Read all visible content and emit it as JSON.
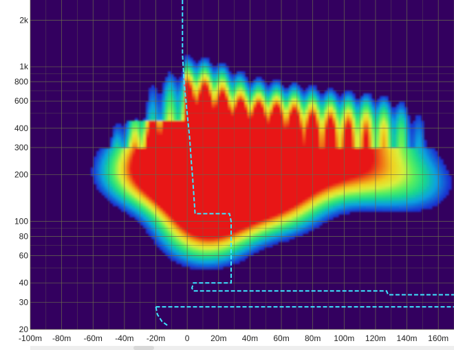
{
  "chart_data": {
    "type": "heatmap",
    "title": "",
    "xlabel": "",
    "ylabel": "",
    "x_scale": "linear",
    "y_scale": "log",
    "xlim": [
      -100,
      170
    ],
    "ylim": [
      20,
      2700
    ],
    "grid": true,
    "x_ticks": [
      {
        "value": -100,
        "label": "-100m"
      },
      {
        "value": -80,
        "label": "-80m"
      },
      {
        "value": -60,
        "label": "-60m"
      },
      {
        "value": -40,
        "label": "-40m"
      },
      {
        "value": -20,
        "label": "-20m"
      },
      {
        "value": 0,
        "label": "0"
      },
      {
        "value": 20,
        "label": "20m"
      },
      {
        "value": 40,
        "label": "40m"
      },
      {
        "value": 60,
        "label": "60m"
      },
      {
        "value": 80,
        "label": "80m"
      },
      {
        "value": 100,
        "label": "100m"
      },
      {
        "value": 120,
        "label": "120m"
      },
      {
        "value": 140,
        "label": "140m"
      },
      {
        "value": 160,
        "label": "160m"
      }
    ],
    "y_ticks": [
      {
        "value": 2000,
        "label": "2k"
      },
      {
        "value": 1000,
        "label": "1k"
      },
      {
        "value": 800,
        "label": "800"
      },
      {
        "value": 600,
        "label": "600"
      },
      {
        "value": 400,
        "label": "400"
      },
      {
        "value": 300,
        "label": "300"
      },
      {
        "value": 200,
        "label": "200"
      },
      {
        "value": 100,
        "label": "100"
      },
      {
        "value": 80,
        "label": "80"
      },
      {
        "value": 60,
        "label": "60"
      },
      {
        "value": 40,
        "label": "40"
      },
      {
        "value": 30,
        "label": "30"
      },
      {
        "value": 20,
        "label": "20"
      }
    ],
    "y_minor_grid": [
      900,
      700,
      500,
      90,
      70,
      50
    ],
    "colors": {
      "background": "#33005f",
      "grid": "#6a6a4e",
      "ridge_line": "#3ee6ff",
      "colormap": [
        "#33005f",
        "#1a2fd0",
        "#0aa0e0",
        "#18d88c",
        "#5cf05c",
        "#d8f03c",
        "#f0d020",
        "#f07818",
        "#e81818"
      ]
    },
    "ridge_line": [
      {
        "x": -3,
        "y": 2700
      },
      {
        "x": -3,
        "y": 1200
      },
      {
        "x": -2,
        "y": 800
      },
      {
        "x": 0,
        "y": 500
      },
      {
        "x": 1.5,
        "y": 350
      },
      {
        "x": 2.5,
        "y": 250
      },
      {
        "x": 3.5,
        "y": 190
      },
      {
        "x": 5,
        "y": 112
      },
      {
        "x": 27,
        "y": 112
      },
      {
        "x": 28,
        "y": 100
      },
      {
        "x": 28,
        "y": 40
      },
      {
        "x": 4,
        "y": 40
      },
      {
        "x": 3,
        "y": 37
      },
      {
        "x": 4,
        "y": 35.5
      },
      {
        "x": 127,
        "y": 35.5
      },
      {
        "x": 128,
        "y": 33.5
      },
      {
        "x": 170,
        "y": 33.5
      }
    ],
    "ridge_line_low": [
      {
        "x": -20,
        "y": 28
      },
      {
        "x": 170,
        "y": 28
      }
    ],
    "ridge_line_tail": [
      {
        "x": -20,
        "y": 28
      },
      {
        "x": -19,
        "y": 25
      },
      {
        "x": -16,
        "y": 22.5
      },
      {
        "x": -12,
        "y": 21
      }
    ],
    "hotspots": [
      {
        "x": -1,
        "y": 650,
        "amp": 0.55
      },
      {
        "x": -2,
        "y": 350,
        "amp": 0.75
      },
      {
        "x": 3,
        "y": 230,
        "amp": 0.98
      },
      {
        "x": 6,
        "y": 180,
        "amp": 0.9
      },
      {
        "x": 15,
        "y": 220,
        "amp": 0.78
      },
      {
        "x": 25,
        "y": 180,
        "amp": 0.75
      },
      {
        "x": 35,
        "y": 230,
        "amp": 0.72
      },
      {
        "x": 45,
        "y": 200,
        "amp": 0.66
      },
      {
        "x": 55,
        "y": 240,
        "amp": 0.6
      },
      {
        "x": 70,
        "y": 210,
        "amp": 0.52
      },
      {
        "x": 90,
        "y": 230,
        "amp": 0.44
      },
      {
        "x": 110,
        "y": 210,
        "amp": 0.36
      },
      {
        "x": 130,
        "y": 200,
        "amp": 0.28
      },
      {
        "x": 150,
        "y": 170,
        "amp": 0.2
      },
      {
        "x": 10,
        "y": 120,
        "amp": 0.7
      },
      {
        "x": 30,
        "y": 130,
        "amp": 0.6
      },
      {
        "x": 60,
        "y": 130,
        "amp": 0.45
      },
      {
        "x": 20,
        "y": 380,
        "amp": 0.62
      },
      {
        "x": 40,
        "y": 400,
        "amp": 0.55
      },
      {
        "x": 55,
        "y": 450,
        "amp": 0.5
      },
      {
        "x": 75,
        "y": 400,
        "amp": 0.45
      },
      {
        "x": 95,
        "y": 380,
        "amp": 0.38
      },
      {
        "x": 115,
        "y": 400,
        "amp": 0.3
      },
      {
        "x": 130,
        "y": 380,
        "amp": 0.22
      },
      {
        "x": -20,
        "y": 200,
        "amp": 0.45
      },
      {
        "x": -35,
        "y": 210,
        "amp": 0.3
      },
      {
        "x": -12,
        "y": 350,
        "amp": 0.4
      },
      {
        "x": 12,
        "y": 80,
        "amp": 0.45
      },
      {
        "x": 8,
        "y": 600,
        "amp": 0.5
      }
    ]
  }
}
